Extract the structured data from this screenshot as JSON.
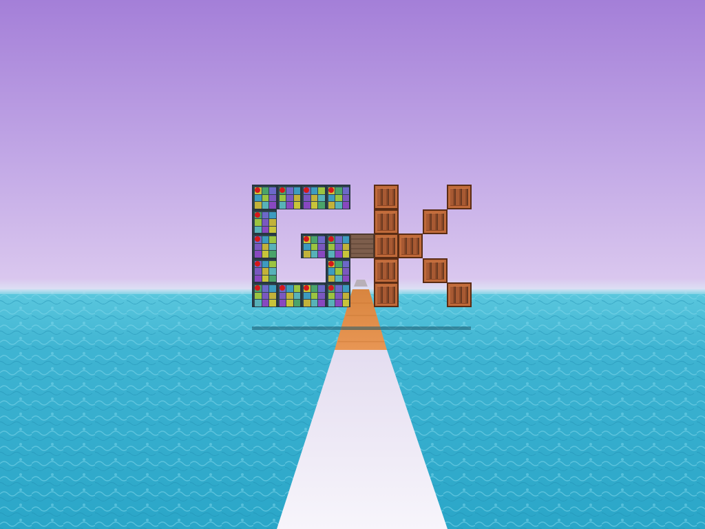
{
  "scene": {
    "title": "",
    "colors": {
      "sky_top": "#a47fd8",
      "sky_mid": "#c2a8e6",
      "sky_horizon": "#dccaef",
      "water_near": "#2aa6c8",
      "water_far": "#5cc8de",
      "path_white": "#f0ecf6",
      "path_orange": "#e08a45",
      "crate": "#a85a33",
      "glass_frame": "#2c3b44"
    },
    "sign": {
      "letters": [
        "G",
        "K"
      ],
      "letter_g_material": "stained-glass-block",
      "letter_k_material": "wooden-crate-block",
      "center_block_material": "engraved-stone-block"
    },
    "path": {
      "near_material": "white-panel",
      "far_material": "orange-wood-plank",
      "far_marker": "grey-stone-step"
    }
  }
}
